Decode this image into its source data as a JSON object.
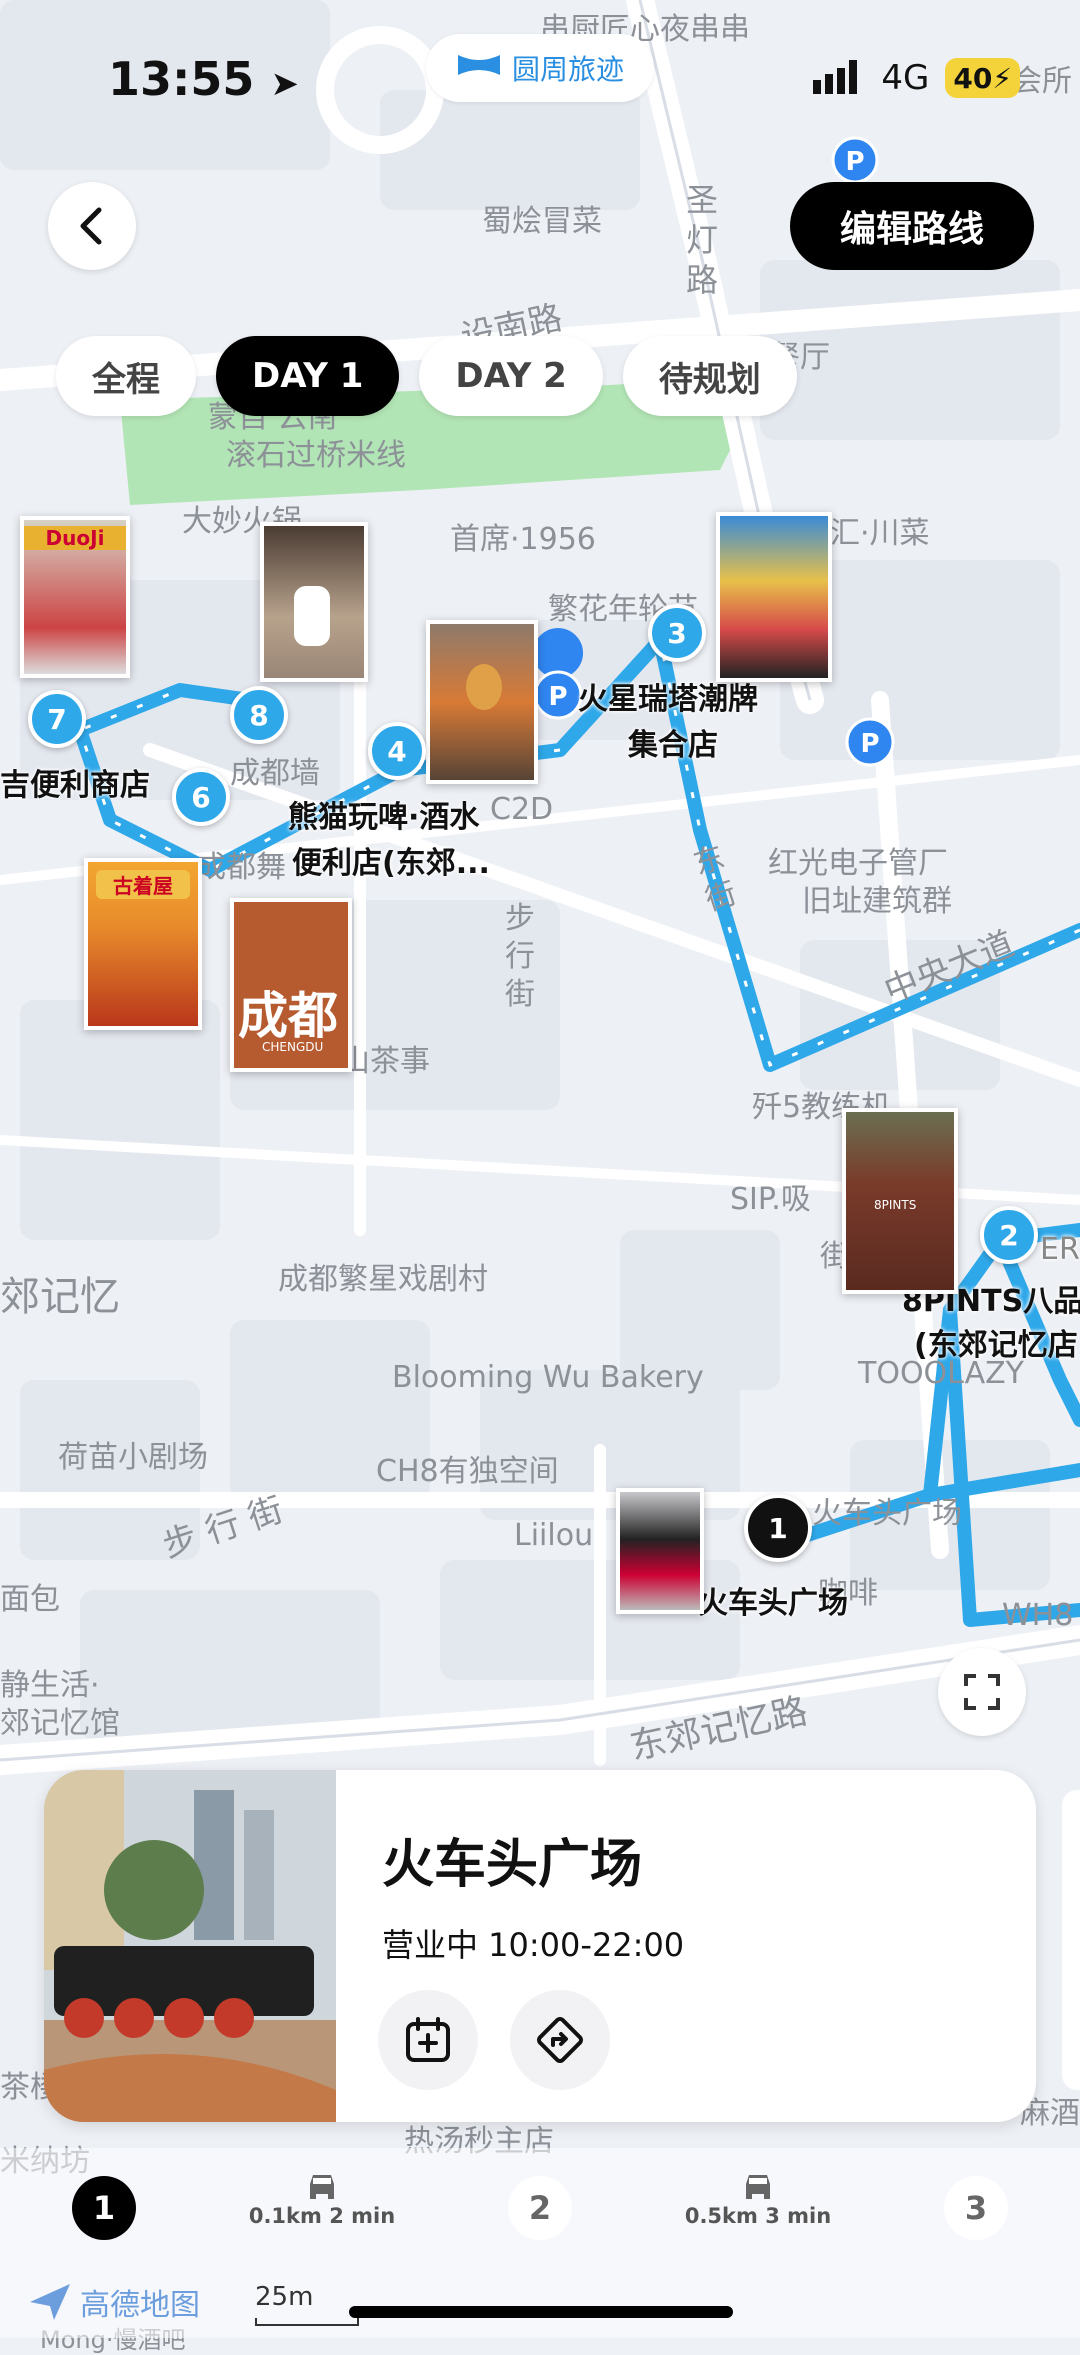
{
  "status_bar": {
    "time": "13:55",
    "app_name": "圆周旅迹",
    "network": "4G",
    "battery": "40"
  },
  "header": {
    "edit_route_label": "编辑路线"
  },
  "tabs": [
    {
      "label": "全程",
      "active": false
    },
    {
      "label": "DAY 1",
      "active": true
    },
    {
      "label": "DAY 2",
      "active": false
    },
    {
      "label": "待规划",
      "active": false
    }
  ],
  "map": {
    "street_labels": {
      "shengdeng": "圣灯路",
      "jianshe": "设南路",
      "zhongyang": "中央大道",
      "dongjiao": "东郊记忆路",
      "buxing1": "步行街",
      "buxing2": "步 行 街",
      "jiedong": "东街",
      "jie_part": "街"
    },
    "pois": {
      "chuanchuan": "串厨匠心夜串串",
      "dongan": "东岸会所",
      "shukuai": "蜀烩冒菜",
      "canting": "会餐厅",
      "yunnan1": "蒙自 云南",
      "yunnan2": "滚石过桥米线",
      "damiao": "大妙火锅",
      "shouxi": "首席·1956",
      "fanhua": "繁花年轮节",
      "wuhui": "汇·川菜",
      "chengduqiang": "成都墙",
      "c2d": "C2D",
      "hongguang1": "红光电子管厂",
      "hongguang2": "旧址建筑群",
      "chengduwu": "成都舞",
      "shanchashi": "山茶事",
      "jian5": "歼5教练机",
      "sip": "SIP.吸",
      "dongjiaojiyi": "郊记忆",
      "fanxing": "成都繁星戏剧村",
      "blooming": "Blooming Wu Bakery",
      "toolazy": "TOOOLAZY",
      "hemiao": "荷苗小剧场",
      "ch8": "CH8有独空间",
      "liilou": "Liilou",
      "huochetou_area": "火车头广场",
      "kafei": "咖啡",
      "mianbao": "面包",
      "wh8": "WH8",
      "jingsheng1": "静生活·",
      "jingsheng2": "郊记忆馆",
      "chaguan": "茶楼",
      "reshu": "热汤秒主店",
      "mishu": "米纳坊",
      "mazui": "麻酒",
      "mengbar": "Mong·慢酒吧"
    },
    "stop_labels": {
      "s3a": "火星瑞塔潮牌",
      "s3b": "集合店",
      "s4a": "熊猫玩啤·酒水",
      "s4b": "便利店(东郊...",
      "s7": "吉便利商店",
      "s2a": "8PINTS八品",
      "s2b": "(东郊记忆店",
      "s1": "火车头广场",
      "s2_tag": "ER"
    },
    "stop_numbers": [
      "1",
      "2",
      "3",
      "4",
      "6",
      "7",
      "8"
    ],
    "photo_texts": {
      "duoji": "DuoJi",
      "chengdu": "成都",
      "chengdu_en": "CHENGDU",
      "gukeyuan": "古着屋",
      "pints": "8PINTS"
    },
    "parking_label": "P"
  },
  "place_card": {
    "title": "火车头广场",
    "hours": "营业中 10:00-22:00",
    "add_icon": "calendar-add-icon",
    "nav_icon": "navigate-icon"
  },
  "route_bar": {
    "stops": [
      "1",
      "2",
      "3"
    ],
    "segments": [
      {
        "distance": "0.1km",
        "time": "2 min",
        "icon": "car-icon"
      },
      {
        "distance": "0.5km",
        "time": "3 min",
        "icon": "car-icon"
      }
    ]
  },
  "footer": {
    "map_logo": "高德地图",
    "scale": "25m"
  },
  "colors": {
    "route": "#2fa8ea",
    "park": "#a7e3a9",
    "active": "#000000",
    "accent": "#2a8fe0"
  }
}
